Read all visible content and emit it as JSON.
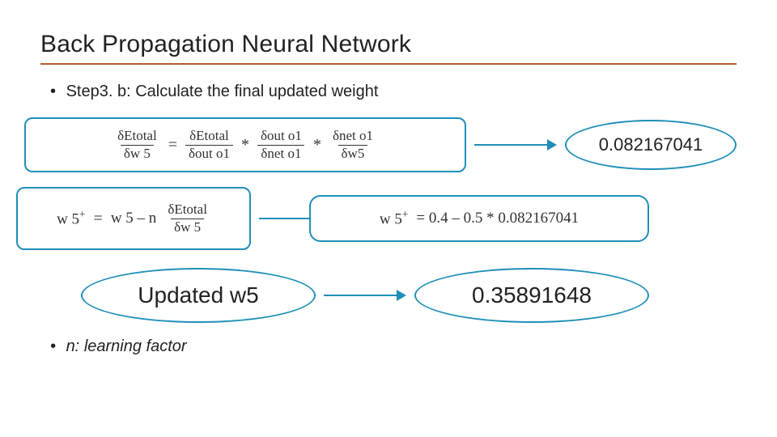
{
  "title": "Back Propagation Neural Network",
  "bullet1_prefix": "Step3. b: ",
  "bullet1_rest": "Calculate the final updated weight",
  "note_prefix": "n: ",
  "note_rest": "learning factor",
  "eq1": {
    "f1_num": "δEtotal",
    "f1_den": "δw 5",
    "eq": "=",
    "f2_num": "δEtotal",
    "f2_den": "δout o1",
    "star1": "*",
    "f3_num": "δout o1",
    "f3_den": "δnet o1",
    "star2": "*",
    "f4_num": "δnet o1",
    "f4_den": "δw5"
  },
  "eq1_result": "0.082167041",
  "eq2": {
    "lhs_pre": "w 5",
    "lhs_sup": "+",
    "eq": "=",
    "rhs_a": "w 5 – n",
    "frac_num": "δEtotal",
    "frac_den": "δw 5"
  },
  "eq2_result": {
    "lhs_pre": "w 5",
    "lhs_sup": "+",
    "text": " = 0.4 – 0.5 * 0.082167041"
  },
  "eq3_left": "Updated w5",
  "eq3_right": "0.35891648"
}
